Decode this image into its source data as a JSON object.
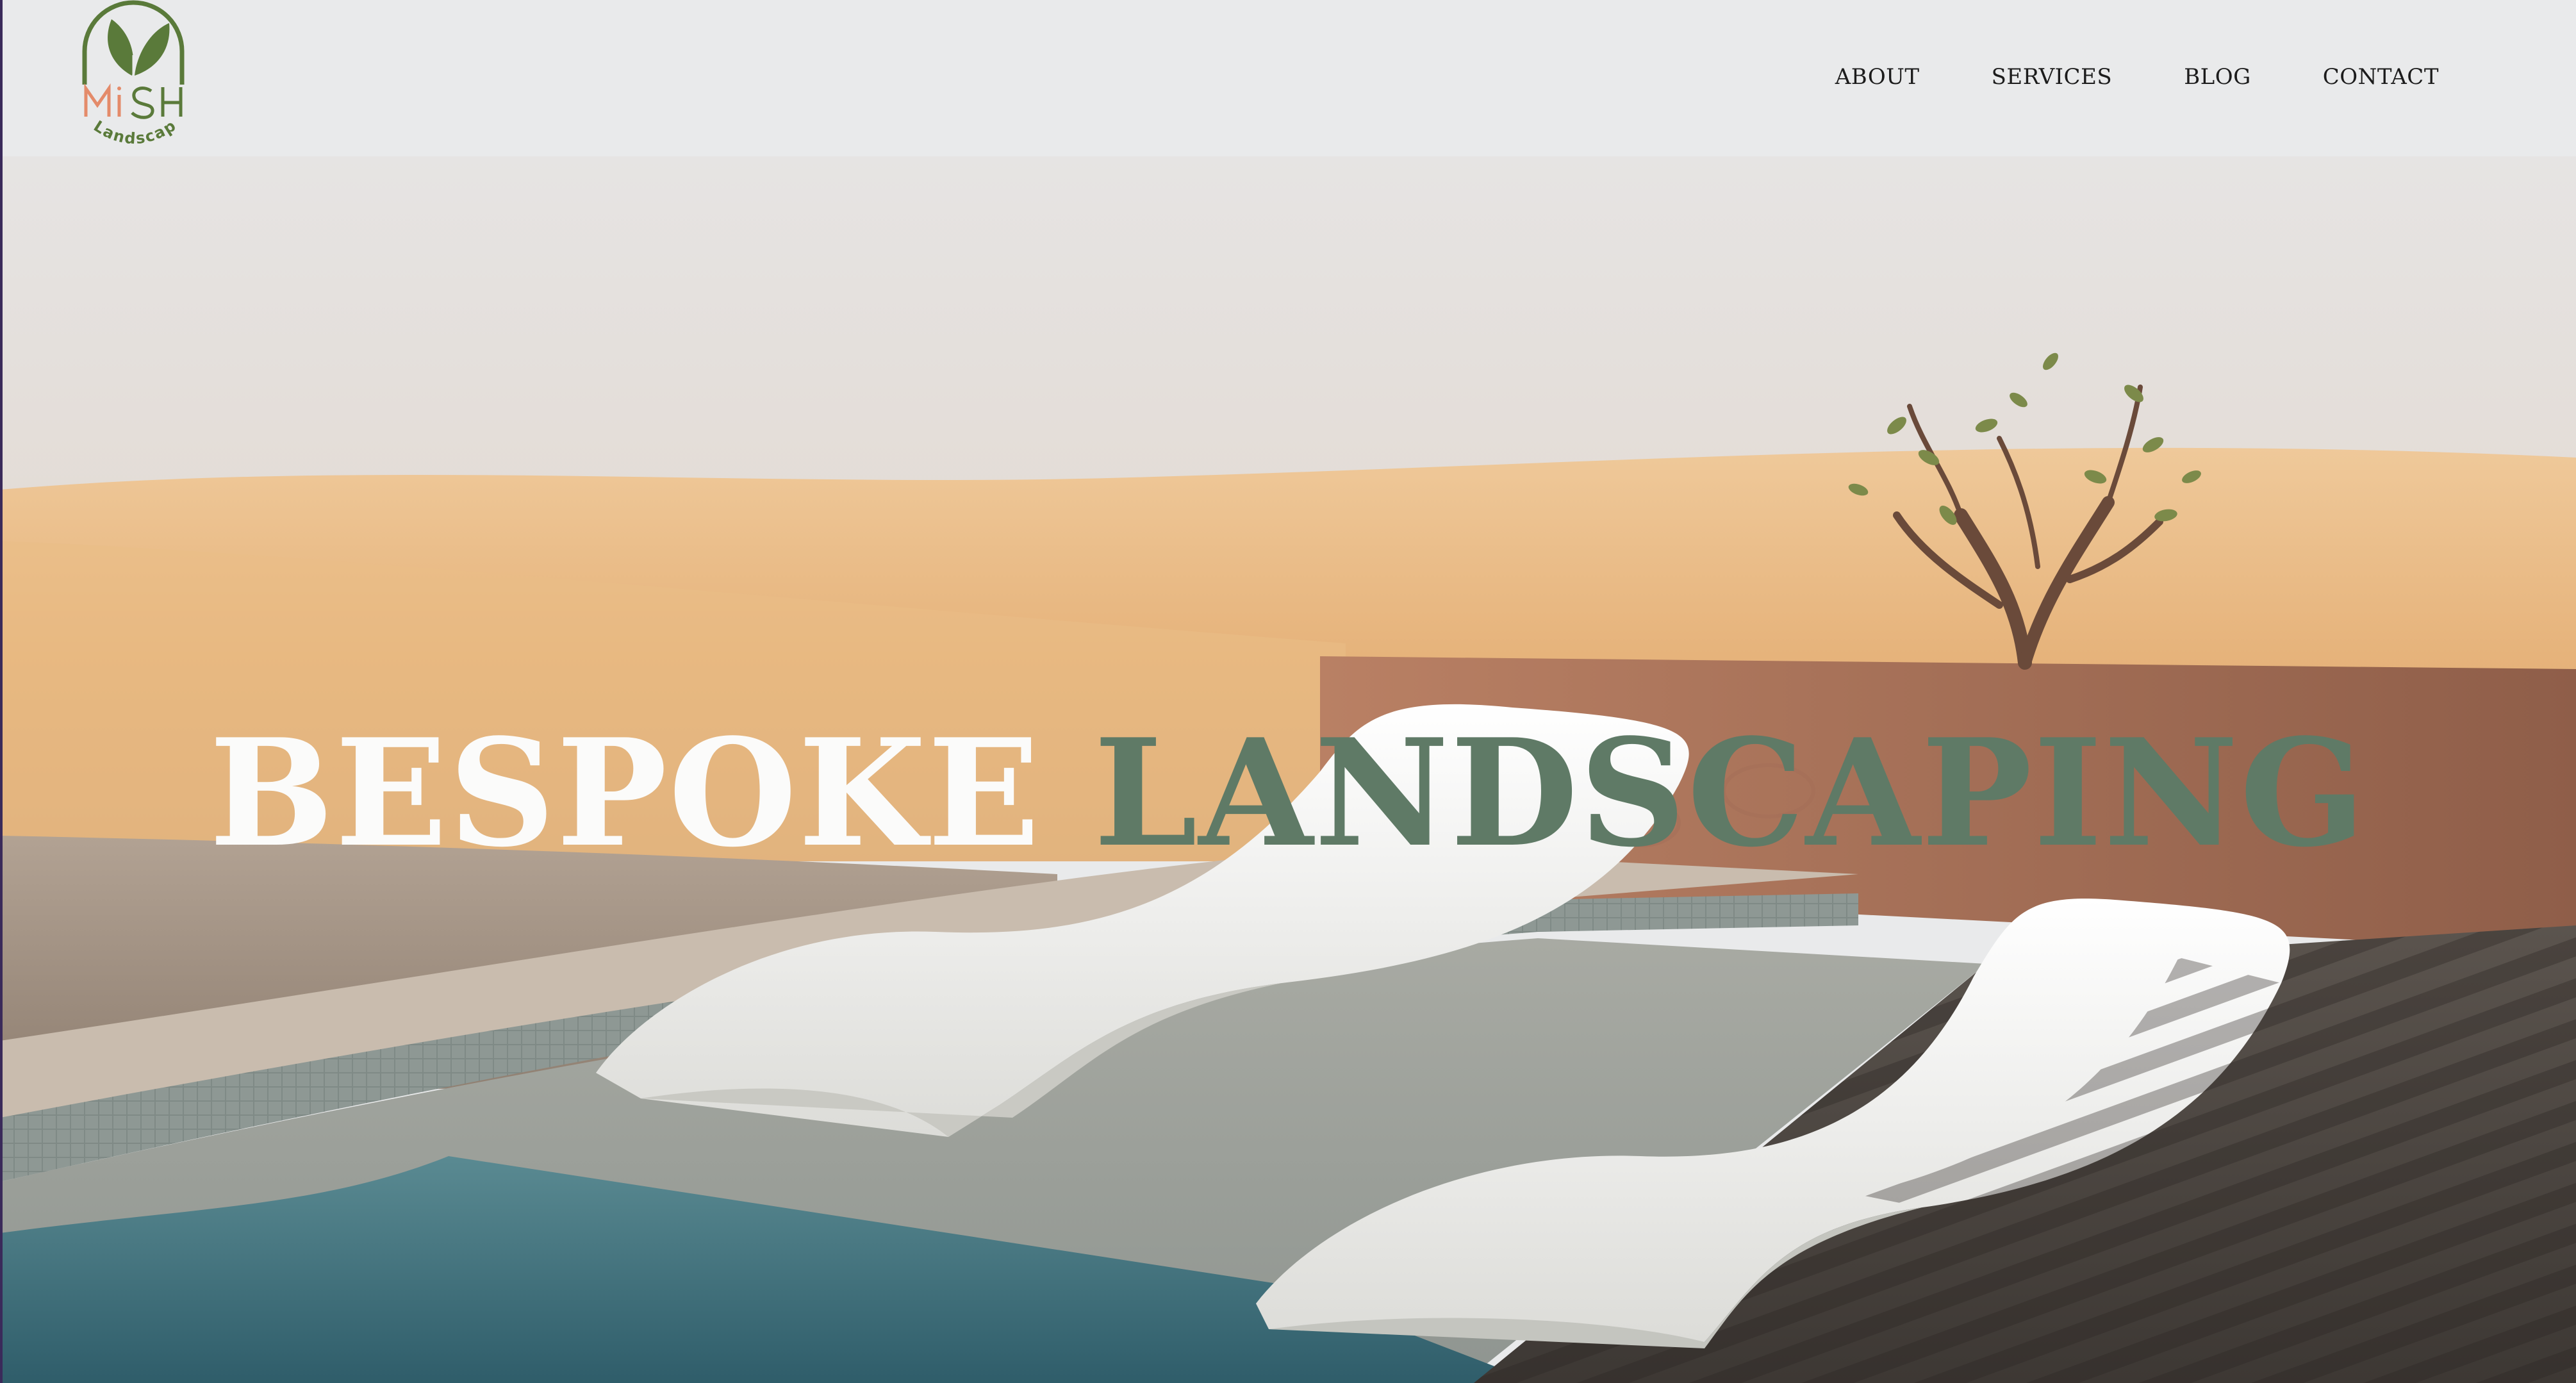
{
  "brand": {
    "logo_text_main": "MiSH",
    "logo_text_sub": "Landscape",
    "logo_color": "#5a7a3a",
    "logo_accent_color": "#e48b6a"
  },
  "nav": {
    "items": [
      {
        "label": "ABOUT"
      },
      {
        "label": "SERVICES"
      },
      {
        "label": "BLOG"
      },
      {
        "label": "CONTACT"
      }
    ]
  },
  "hero": {
    "headline_word1": "BESPOKE",
    "headline_word2": "LANDSCAPING",
    "headline_word1_color": "#fbfbfa",
    "headline_word2_color": "#5f7a66",
    "image_subject": "desert-pool-loungers"
  },
  "colors": {
    "header_bg": "#e9eaeb",
    "nav_text": "#1c1c1c",
    "sand": "#e7b77f",
    "pool_water": "#3e6e7a",
    "deck": "#4a4540",
    "wall": "#a9745c"
  }
}
